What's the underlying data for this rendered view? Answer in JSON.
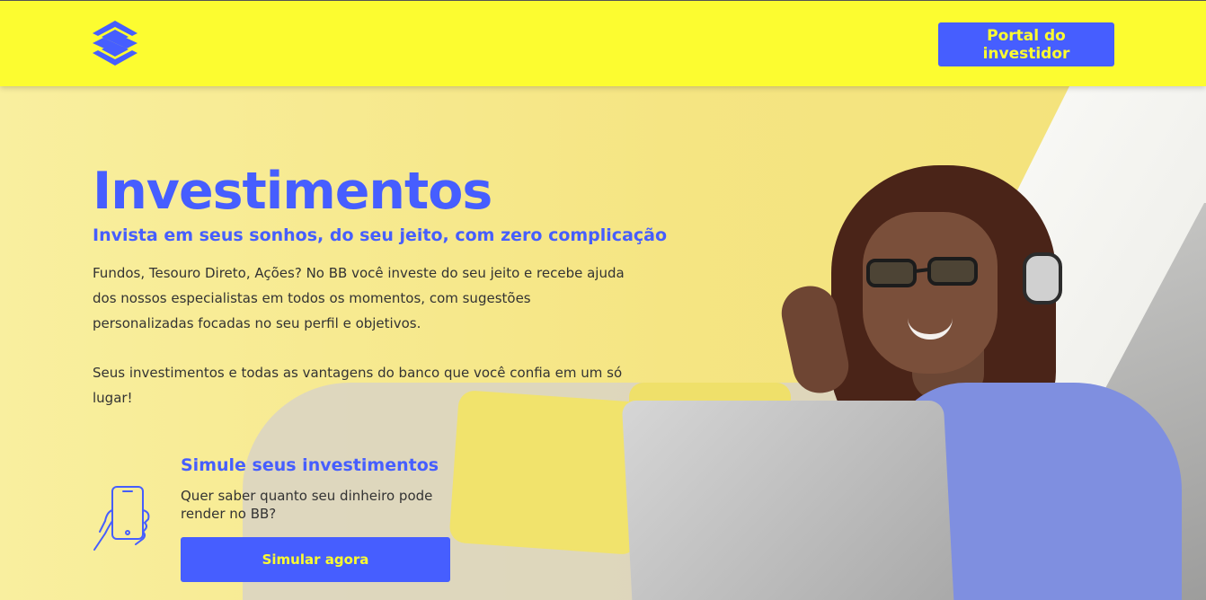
{
  "header": {
    "logo_icon": "banco-do-brasil-logo",
    "portal_label": "Portal do investidor"
  },
  "hero": {
    "title": "Investimentos",
    "subtitle": "Invista em seus sonhos, do seu jeito, com zero complicação",
    "paragraph1": "Fundos, Tesouro Direto, Ações? No BB você investe do seu jeito e recebe ajuda dos nossos especialistas em todos os momentos, com sugestões personalizadas focadas no seu perfil e objetivos.",
    "paragraph2": "Seus investimentos e todas as vantagens do banco que você confia em um só lugar!"
  },
  "simulation": {
    "icon": "phone-in-hand-icon",
    "title": "Simule seus investimentos",
    "text": "Quer saber quanto seu dinheiro pode render no BB?",
    "button_label": "Simular agora"
  },
  "colors": {
    "brand_yellow": "#fcfc30",
    "brand_blue": "#465eff",
    "text": "#333333"
  }
}
